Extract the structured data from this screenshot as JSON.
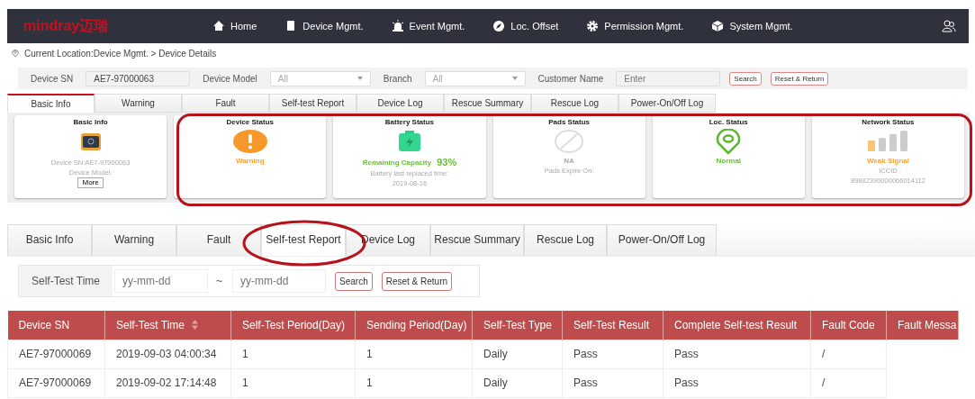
{
  "header": {
    "logo": "mindray迈瑞",
    "nav": [
      "Home",
      "Device Mgmt.",
      "Event Mgmt.",
      "Loc. Offset",
      "Permission Mgmt.",
      "System Mgmt."
    ]
  },
  "breadcrumb": "Current Location:Device Mgmt. > Device Details",
  "filters": [
    {
      "label": "Device SN",
      "kind": "text",
      "value": "AE7-97000063"
    },
    {
      "label": "Device Model",
      "kind": "select",
      "value": "All"
    },
    {
      "label": "Branch",
      "kind": "select",
      "value": "All"
    },
    {
      "label": "Customer Name",
      "kind": "text",
      "placeholder": "Enter"
    }
  ],
  "filter_buttons": [
    "Search",
    "Reset & Return"
  ],
  "tabs": [
    {
      "label": "Basic Info",
      "selected": true
    },
    {
      "label": "Warning",
      "selected": false
    },
    {
      "label": "Fault",
      "selected": false
    },
    {
      "label": "Self-test Report",
      "selected": false
    },
    {
      "label": "Device Log",
      "selected": false
    },
    {
      "label": "Rescue Summary",
      "selected": false
    },
    {
      "label": "Rescue Log",
      "selected": false
    },
    {
      "label": "Power-On/Off Log",
      "selected": false
    }
  ],
  "cards": [
    {
      "kind": "info",
      "title": "Basic Info",
      "lines": [
        "Device SN:AE7-97000063",
        "Device Model:"
      ],
      "button": "More"
    },
    {
      "kind": "warning",
      "title": "Device Status",
      "status": "Warning"
    },
    {
      "kind": "battery",
      "title": "Battery Status",
      "status": "Remaining Capacity",
      "value": "93%",
      "lines": [
        "Battery last replaced time:",
        "2019-08-16"
      ]
    },
    {
      "kind": "na",
      "title": "Pads Status",
      "status": "NA",
      "lines": [
        "Pads Expire On:"
      ]
    },
    {
      "kind": "location",
      "title": "Loc. Status",
      "status": "Normal"
    },
    {
      "kind": "signal",
      "title": "Network Status",
      "status": "Weak Signal",
      "lines": [
        "ICCID",
        "89882390000066014112"
      ]
    }
  ],
  "detail": {
    "tabs": [
      {
        "label": "Basic Info",
        "selected": false
      },
      {
        "label": "Warning",
        "selected": false
      },
      {
        "label": "Fault",
        "selected": false
      },
      {
        "label": "Self-test Report",
        "selected": true
      },
      {
        "label": "Device Log",
        "selected": false
      },
      {
        "label": "Rescue Summary",
        "selected": false
      },
      {
        "label": "Rescue Log",
        "selected": false
      },
      {
        "label": "Power-On/Off Log",
        "selected": false
      }
    ],
    "filter": {
      "label": "Self-Test Time",
      "from_placeholder": "yy-mm-dd",
      "separator": "~",
      "to_placeholder": "yy-mm-dd",
      "buttons": [
        "Search",
        "Reset & Return"
      ]
    },
    "table": {
      "columns": [
        {
          "label": "Device SN",
          "sortable": false
        },
        {
          "label": "Self-Test Time",
          "sortable": true
        },
        {
          "label": "Self-Test Period(Day)",
          "sortable": false
        },
        {
          "label": "Sending Period(Day)",
          "sortable": false
        },
        {
          "label": "Self-Test Type",
          "sortable": false
        },
        {
          "label": "Self-Test Result",
          "sortable": false
        },
        {
          "label": "Complete Self-test Result",
          "sortable": false
        },
        {
          "label": "Fault Code",
          "sortable": false
        },
        {
          "label": "Fault Messa",
          "sortable": false
        }
      ],
      "rows": [
        [
          "AE7-97000069",
          "2019-09-03 04:00:34",
          "1",
          "1",
          "Daily",
          "Pass",
          "Pass",
          "/",
          ""
        ],
        [
          "AE7-97000069",
          "2019-09-02 17:14:48",
          "1",
          "1",
          "Daily",
          "Pass",
          "Pass",
          "/",
          ""
        ]
      ]
    }
  }
}
